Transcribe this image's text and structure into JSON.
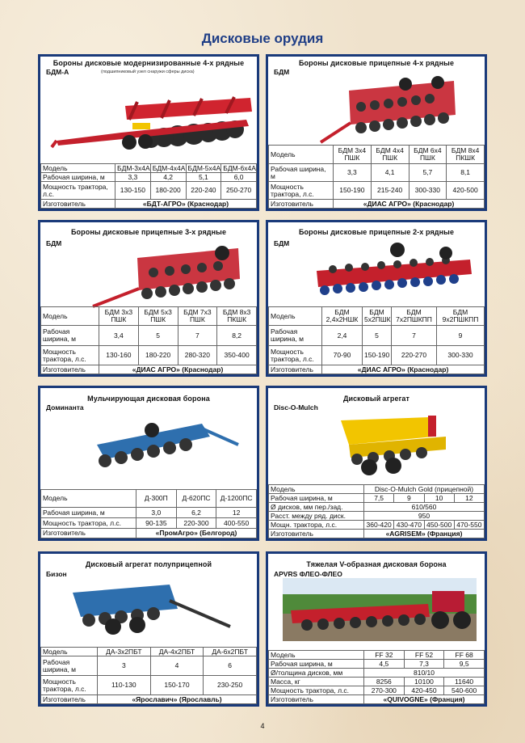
{
  "page": {
    "title": "Дисковые орудия",
    "number": "4"
  },
  "cards": [
    {
      "title": "Бороны дисковые модернизированные 4-х рядные",
      "subtitle": "(подшипниковый узел снаружи сферы диска)",
      "model": "БДМ-А",
      "rows": [
        [
          "Модель",
          "БДМ-3х4А",
          "БДМ-4х4А",
          "БДМ-5х4А",
          "БДМ-6х4А"
        ],
        [
          "Рабочая ширина, м",
          "3,3",
          "4,2",
          "5,1",
          "6,0"
        ],
        [
          "Мощность трактора, л.с.",
          "130-150",
          "180-200",
          "220-240",
          "250-270"
        ]
      ],
      "manufacturer_label": "Изготовитель",
      "manufacturer": "«БДТ-АГРО» (Краснодар)"
    },
    {
      "title": "Бороны дисковые прицепные 4-х рядные",
      "model": "БДМ",
      "rows": [
        [
          "Модель",
          "БДМ 3х4 ПШК",
          "БДМ 4х4 ПШК",
          "БДМ 6х4 ПШК",
          "БДМ 8х4 ПКШК"
        ],
        [
          "Рабочая ширина, м",
          "3,3",
          "4,1",
          "5,7",
          "8,1"
        ],
        [
          "Мощность трактора, л.с.",
          "150-190",
          "215-240",
          "300-330",
          "420-500"
        ]
      ],
      "manufacturer_label": "Изготовитель",
      "manufacturer": "«ДИАС АГРО» (Краснодар)"
    },
    {
      "title": "Бороны дисковые прицепные 3-х рядные",
      "model": "БДМ",
      "rows": [
        [
          "Модель",
          "БДМ 3х3 ПШК",
          "БДМ 5х3 ПШК",
          "БДМ 7х3 ПШК",
          "БДМ 8х3 ПКШК"
        ],
        [
          "Рабочая ширина, м",
          "3,4",
          "5",
          "7",
          "8,2"
        ],
        [
          "Мощность трактора, л.с.",
          "130-160",
          "180-220",
          "280-320",
          "350-400"
        ]
      ],
      "manufacturer_label": "Изготовитель",
      "manufacturer": "«ДИАС АГРО» (Краснодар)"
    },
    {
      "title": "Бороны дисковые прицепные 2-х рядные",
      "model": "БДМ",
      "rows": [
        [
          "Модель",
          "БДМ 2,4х2НШК",
          "БДМ 5х2ПШК",
          "БДМ 7х2ПШКПП",
          "БДМ 9х2ПШКПП"
        ],
        [
          "Рабочая ширина, м",
          "2,4",
          "5",
          "7",
          "9"
        ],
        [
          "Мощность трактора, л.с.",
          "70-90",
          "150-190",
          "220-270",
          "300-330"
        ]
      ],
      "manufacturer_label": "Изготовитель",
      "manufacturer": "«ДИАС АГРО» (Краснодар)"
    },
    {
      "title": "Мульчирующая дисковая борона",
      "model": "Доминанта",
      "rows": [
        [
          "Модель",
          "Д-300П",
          "Д-620ПС",
          "Д-1200ПС"
        ],
        [
          "Рабочая ширина, м",
          "3,0",
          "6,2",
          "12"
        ],
        [
          "Мощность трактора, л.с.",
          "90-135",
          "220-300",
          "400-550"
        ]
      ],
      "manufacturer_label": "Изготовитель",
      "manufacturer": "«ПромАгро» (Белгород)"
    },
    {
      "title": "Дисковый агрегат",
      "model": "Disc-O-Mulch",
      "model_row": [
        "Модель",
        "Disc-O-Mulch Gold (прицепной)"
      ],
      "width_row": [
        "Рабочая ширина, м",
        "7,5",
        "9",
        "10",
        "12"
      ],
      "span_rows": [
        [
          "Ø дисков, мм пер./зад.",
          "610/560"
        ],
        [
          "Расст. между ряд. диск.",
          "950"
        ]
      ],
      "power_row": [
        "Мощн. трактора, л.с.",
        "360-420",
        "430-470",
        "450-500",
        "470-550"
      ],
      "manufacturer_label": "Изготовитель",
      "manufacturer": "«AGRISEM» (Франция)"
    },
    {
      "title": "Дисковый агрегат полуприцепной",
      "model": "Бизон",
      "rows": [
        [
          "Модель",
          "ДА-3х2ПБТ",
          "ДА-4х2ПБТ",
          "ДА-6х2ПБТ"
        ],
        [
          "Рабочая ширина, м",
          "3",
          "4",
          "6"
        ],
        [
          "Мощность трактора, л.с.",
          "110-130",
          "150-170",
          "230-250"
        ]
      ],
      "manufacturer_label": "Изготовитель",
      "manufacturer": "«Ярославич» (Ярославль)"
    },
    {
      "title": "Тяжелая V-образная дисковая борона",
      "model": "APVRS ФЛЕО-ФЛЕО",
      "rows_a": [
        [
          "Модель",
          "FF 32",
          "FF 52",
          "FF 68"
        ],
        [
          "Рабочая ширина, м",
          "4,5",
          "7,3",
          "9,5"
        ]
      ],
      "span_row": [
        "Ø/толщина дисков, мм",
        "810/10"
      ],
      "rows_b": [
        [
          "Масса, кг",
          "8256",
          "10100",
          "11640"
        ],
        [
          "Мощность трактора, л.с.",
          "270-300",
          "420-450",
          "540-600"
        ]
      ],
      "manufacturer_label": "Изготовитель",
      "manufacturer": "«QUIVOGNE» (Франция)"
    }
  ],
  "colors": {
    "border": "#1a3a7a",
    "title": "#1f3e86",
    "implement_red": "#c4202c",
    "implement_blue": "#2e6fae",
    "implement_yellow": "#f2c500"
  },
  "illustrations": [
    "red-disc-harrow-image",
    "yellow-disc-aggregate-image",
    "blue-disc-harrow-image"
  ]
}
